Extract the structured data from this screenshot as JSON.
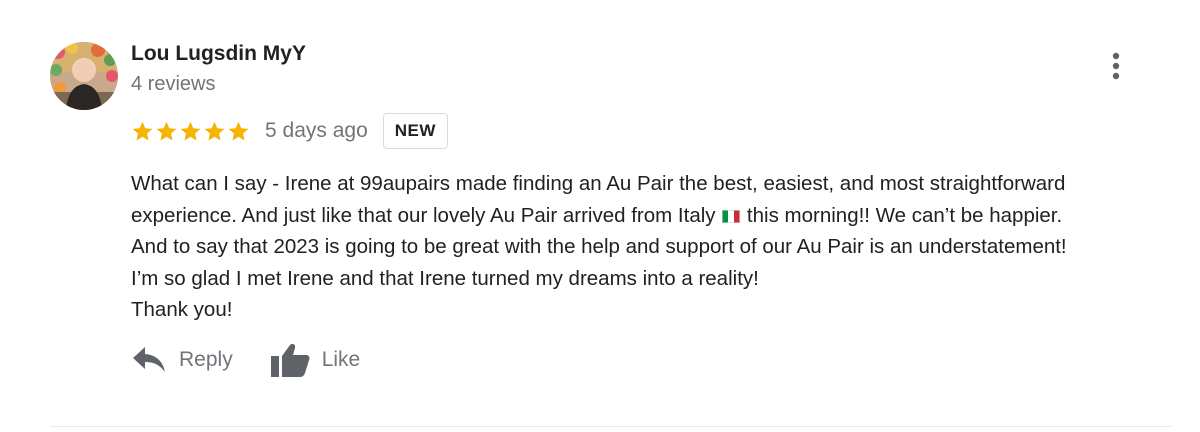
{
  "review": {
    "author": {
      "name": "Lou Lugsdin MyY",
      "meta": "4 reviews"
    },
    "rating": 5,
    "rating_max": 5,
    "date": "5 days ago",
    "badge": "NEW",
    "text": {
      "line1": "What can I say - Irene at 99aupairs made finding an Au Pair the best, easiest, and most straightforward",
      "line2_before_flag": "experience. And just like that our lovely Au Pair arrived from Italy ",
      "line2_after_flag": " this morning!! We can’t be happier.",
      "line3": "And to say that 2023 is going to be great with the help and support of our Au Pair is an understatement!",
      "line4": "I’m so glad I met Irene and that Irene turned my dreams into a reality!",
      "line5": "Thank you!"
    },
    "actions": {
      "reply_label": "Reply",
      "like_label": "Like"
    }
  },
  "icons": {
    "menu": "more-vertical-icon",
    "star": "star-icon",
    "flag": "italy-flag-icon",
    "reply": "reply-arrow-icon",
    "like": "thumbs-up-icon"
  },
  "colors": {
    "star": "#f4b400",
    "secondary_text": "#70757a",
    "primary_text": "#202124",
    "flag_green": "#009246",
    "flag_white": "#ffffff",
    "flag_red": "#ce2b37"
  }
}
